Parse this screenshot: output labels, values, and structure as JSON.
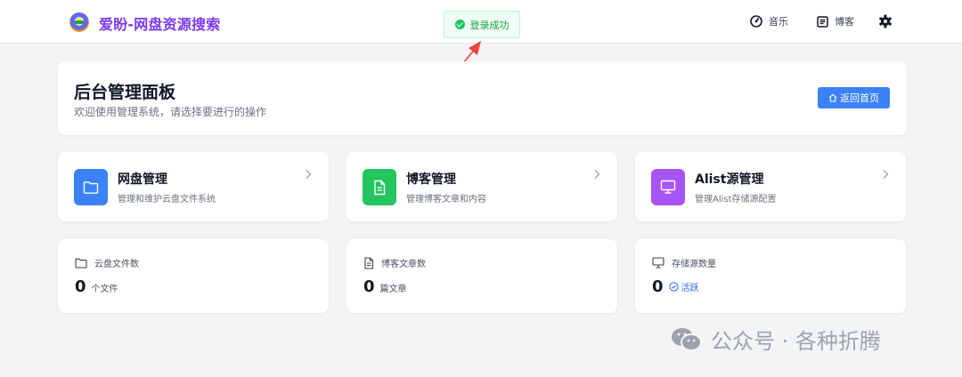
{
  "header": {
    "brand": "爱盼-网盘资源搜索",
    "nav": {
      "music": "音乐",
      "blog": "博客"
    }
  },
  "toast": {
    "message": "登录成功"
  },
  "hero": {
    "title": "后台管理面板",
    "subtitle": "欢迎使用管理系统，请选择要进行的操作",
    "home_button": "返回首页"
  },
  "features": [
    {
      "title": "网盘管理",
      "desc": "管理和维护云盘文件系统",
      "color": "#3b82f6",
      "icon": "folder-icon"
    },
    {
      "title": "博客管理",
      "desc": "管理博客文章和内容",
      "color": "#22c55e",
      "icon": "document-icon"
    },
    {
      "title": "Alist源管理",
      "desc": "管理Alist存储源配置",
      "color": "#a855f7",
      "icon": "monitor-icon"
    }
  ],
  "stats": [
    {
      "label": "云盘文件数",
      "value": "0",
      "unit": "个文件",
      "icon": "folder-icon"
    },
    {
      "label": "博客文章数",
      "value": "0",
      "unit": "篇文章",
      "icon": "document-icon"
    },
    {
      "label": "存储源数量",
      "value": "0",
      "status": "活跃",
      "icon": "monitor-icon"
    }
  ],
  "watermark": {
    "text": "公众号 · 各种折腾"
  }
}
